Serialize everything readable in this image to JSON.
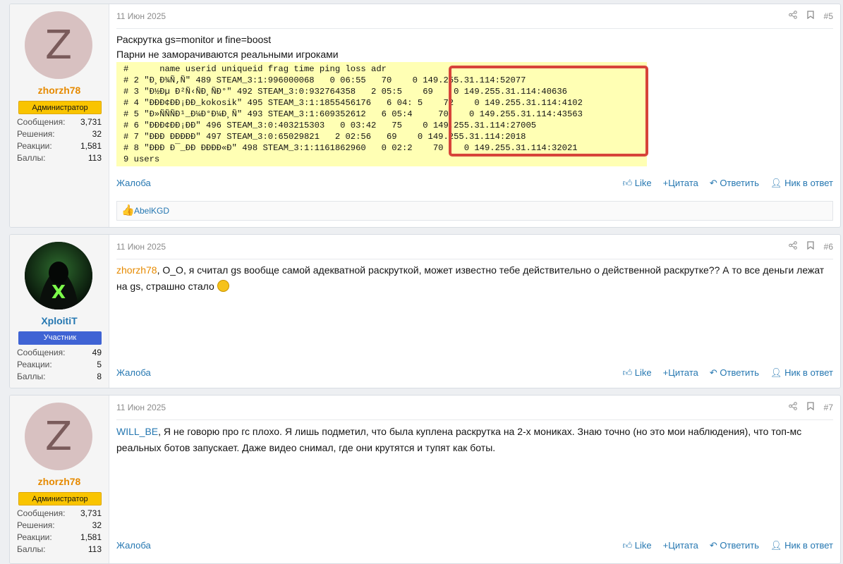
{
  "posts": [
    {
      "user": {
        "avatar_letter": "Z",
        "name": "zhorzh78",
        "role": "Администратор",
        "stats": [
          {
            "label": "Сообщения:",
            "value": "3,731"
          },
          {
            "label": "Решения:",
            "value": "32"
          },
          {
            "label": "Реакции:",
            "value": "1,581"
          },
          {
            "label": "Баллы:",
            "value": "113"
          }
        ]
      },
      "date": "11 Июн 2025",
      "number": "#5",
      "line1": "Раскрутка gs=monitor и fine=boost",
      "line2": "Парни не заморачиваются реальными игроками",
      "code": [
        "#      name userid uniqueid frag time ping loss adr",
        "# 2 \"Ð¸Ð¾Ñ‚Ñ\" 489 STEAM_3:1:996000068   0 06:55   70    0 149.255.31.114:52077",
        "# 3 \"Ð½Ðµ Ð²Ñ‹ÑÐ¸ÑÐ°\" 492 STEAM_3:0:932764358   2 05:5    69    0 149.255.31.114:40636",
        "# 4 \"ÐÐÐ¢ÐÐ¡ÐÐ_kokosik\" 495 STEAM_3:1:1855456176   6 04: 5    72    0 149.255.31.114:4102",
        "# 5 \"Ð»ÑÑÑÐ¹_Ð¼Ð°Ð¼Ð¸Ñ\" 493 STEAM_3:1:609352612   6 05:4     70    0 149.255.31.114:43563",
        "# 6 \"ÐÐÐ¢ÐÐ¡ÐÐ\" 496 STEAM_3:0:403215303   0 03:42   75    0 149.255.31.114:27005",
        "# 7 \"ÐÐÐ ÐÐÐÐÐ\" 497 STEAM_3:0:65029821   2 02:56   69    0 149.255.31.114:2018",
        "# 8 \"ÐÐÐ Ð¯_ÐÐ ÐÐÐÐ«Ð\" 498 STEAM_3:1:1161862960   0 02:2    70    0 149.255.31.114:32021",
        "9 users"
      ],
      "reaction_user": "AbelKGD"
    },
    {
      "user": {
        "name": "XploitiT",
        "role": "Участник",
        "stats": [
          {
            "label": "Сообщения:",
            "value": "49"
          },
          {
            "label": "Реакции:",
            "value": "5"
          },
          {
            "label": "Баллы:",
            "value": "8"
          }
        ]
      },
      "date": "11 Июн 2025",
      "number": "#6",
      "mention": "zhorzh78",
      "text": ", O_O, я считал gs вообще самой адекватной раскруткой, может известно тебе действительно о действенной раскрутке?? А то все деньги лежат на gs, страшно стало"
    },
    {
      "user": {
        "avatar_letter": "Z",
        "name": "zhorzh78",
        "role": "Администратор",
        "stats": [
          {
            "label": "Сообщения:",
            "value": "3,731"
          },
          {
            "label": "Решения:",
            "value": "32"
          },
          {
            "label": "Реакции:",
            "value": "1,581"
          },
          {
            "label": "Баллы:",
            "value": "113"
          }
        ]
      },
      "date": "11 Июн 2025",
      "number": "#7",
      "mention": "WILL_BE",
      "text": ", Я не говорю про гс плохо. Я лишь подметил, что была куплена раскрутка на 2-х мониках. Знаю точно (но это мои наблюдения), что топ-мс реальных ботов запускает. Даже видео снимал, где они крутятся и тупят как боты."
    }
  ],
  "actions": {
    "report": "Жалоба",
    "like": "Like",
    "quote": "Цитата",
    "reply": "Ответить",
    "nick": "Ник в ответ"
  },
  "icons": {
    "share": "share-icon",
    "bookmark": "bookmark-icon",
    "like": "thumb-up-icon",
    "quote": "plus-icon",
    "reply": "reply-icon",
    "nick": "user-icon"
  },
  "colors": {
    "admin_badge": "#f9c400",
    "member_badge": "#3f63d4",
    "link": "#2577b1",
    "admin_name": "#e68a00",
    "code_bg": "#ffffb4",
    "highlight": "#d7443a"
  }
}
